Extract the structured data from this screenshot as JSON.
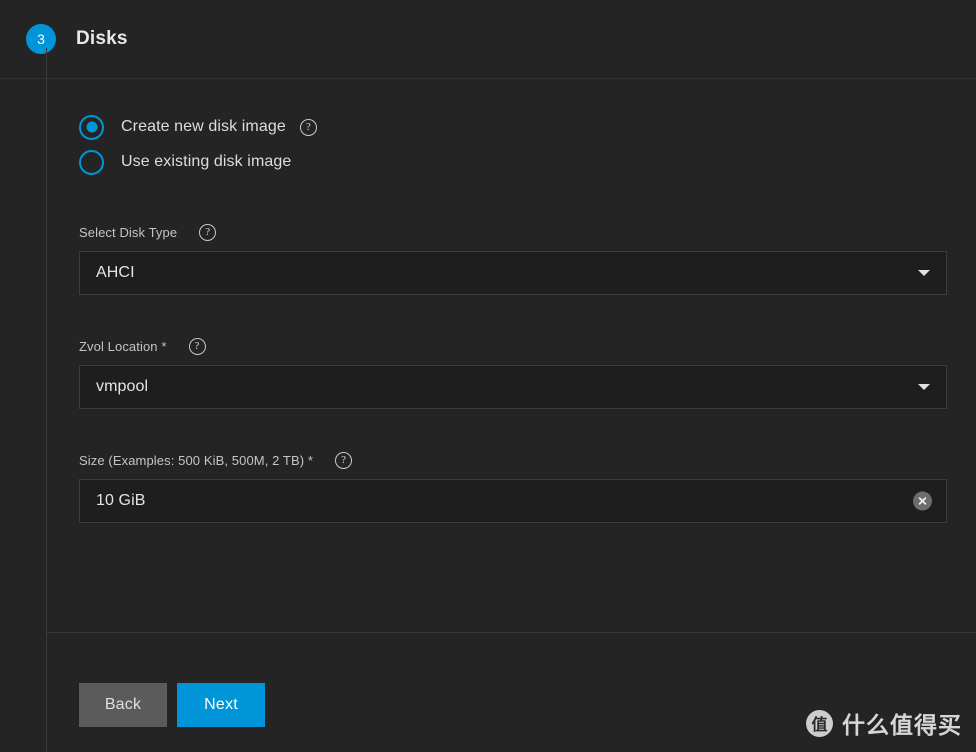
{
  "step": {
    "number": "3",
    "title": "Disks"
  },
  "disk_source": {
    "options": [
      {
        "label": "Create new disk image",
        "selected": true,
        "has_help": true
      },
      {
        "label": "Use existing disk image",
        "selected": false,
        "has_help": false
      }
    ]
  },
  "fields": {
    "disk_type": {
      "label": "Select Disk Type",
      "value": "AHCI",
      "control": "select",
      "help_icon": "help-circle-icon",
      "caret_icon": "chevron-down-icon"
    },
    "zvol_location": {
      "label": "Zvol Location *",
      "value": "vmpool",
      "control": "select",
      "help_icon": "help-circle-icon",
      "caret_icon": "chevron-down-icon"
    },
    "size": {
      "label": "Size (Examples: 500 KiB, 500M, 2 TB) *",
      "value": "10 GiB",
      "placeholder": "",
      "control": "text",
      "help_icon": "help-circle-icon",
      "clear_icon": "clear-circle-icon"
    }
  },
  "actions": {
    "back_label": "Back",
    "next_label": "Next"
  },
  "watermark": {
    "logo_char": "值",
    "text": "什么值得买"
  },
  "colors": {
    "accent": "#0095D8",
    "background": "#242424",
    "field_background": "#1e1e1e",
    "field_border": "#3d3d3d",
    "back_button": "#5b5b5b",
    "text_primary": "#e4e4e4",
    "text_secondary": "#c4c4c4"
  },
  "help_glyph": "?"
}
